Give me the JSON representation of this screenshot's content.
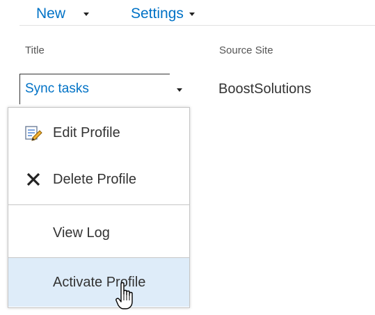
{
  "toolbar": {
    "new_label": "New",
    "settings_label": "Settings"
  },
  "columns": {
    "title": "Title",
    "source_site": "Source Site"
  },
  "row": {
    "title": "Sync tasks",
    "source_site": "BoostSolutions"
  },
  "menu": {
    "items": [
      {
        "label": "Edit Profile",
        "icon": "edit-icon"
      },
      {
        "label": "Delete Profile",
        "icon": "delete-icon"
      },
      {
        "label": "View Log"
      },
      {
        "label": "Activate Profile",
        "hovered": true
      }
    ]
  },
  "colors": {
    "link": "#0072c6",
    "hover": "#deecf9",
    "text": "#333333"
  }
}
